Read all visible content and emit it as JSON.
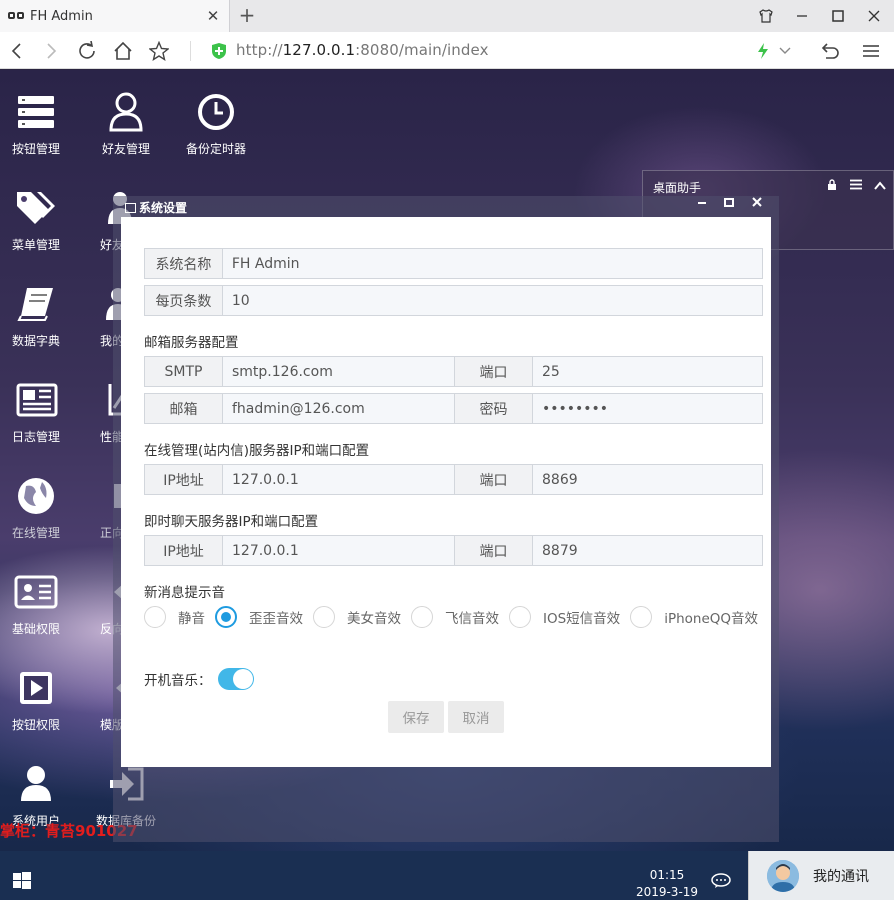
{
  "browser": {
    "tab_title": "FH Admin",
    "url_prefix": "http://",
    "url_host": "127.0.0.1",
    "url_rest": ":8080/main/index"
  },
  "desktop_icons": [
    {
      "label": "按钮管理",
      "icon": "server-list-icon"
    },
    {
      "label": "好友管理",
      "icon": "user-icon"
    },
    {
      "label": "备份定时器",
      "icon": "clock-icon"
    },
    {
      "label": "菜单管理",
      "icon": "tags-icon"
    },
    {
      "label": "好友",
      "icon": "users-icon"
    },
    {
      "label": "数据字典",
      "icon": "book-icon"
    },
    {
      "label": "我的",
      "icon": "users-icon"
    },
    {
      "label": "日志管理",
      "icon": "newspaper-icon"
    },
    {
      "label": "性能",
      "icon": "chart-icon"
    },
    {
      "label": "在线管理",
      "icon": "globe-icon"
    },
    {
      "label": "正向",
      "icon": "puzzle-icon"
    },
    {
      "label": "基础权限",
      "icon": "id-card-icon"
    },
    {
      "label": "反向",
      "icon": "arrow-icon"
    },
    {
      "label": "按钮权限",
      "icon": "play-icon"
    },
    {
      "label": "模版",
      "icon": "template-icon"
    },
    {
      "label": "系统用户",
      "icon": "user-icon"
    },
    {
      "label": "数据库备份",
      "icon": "sign-in-icon"
    }
  ],
  "watermark": "掌柜：青苔901027",
  "helper": {
    "title": "桌面助手"
  },
  "dialog": {
    "title": "系统设置",
    "system_name_label": "系统名称",
    "system_name_value": "FH Admin",
    "page_size_label": "每页条数",
    "page_size_value": "10",
    "mail_section": "邮箱服务器配置",
    "smtp_label": "SMTP",
    "smtp_value": "smtp.126.com",
    "smtp_port_label": "端口",
    "smtp_port_value": "25",
    "mail_label": "邮箱",
    "mail_value": "fhadmin@126.com",
    "password_label": "密码",
    "password_value": "••••••••",
    "online_section": "在线管理(站内信)服务器IP和端口配置",
    "online_ip_label": "IP地址",
    "online_ip_value": "127.0.0.1",
    "online_port_label": "端口",
    "online_port_value": "8869",
    "chat_section": "即时聊天服务器IP和端口配置",
    "chat_ip_label": "IP地址",
    "chat_ip_value": "127.0.0.1",
    "chat_port_label": "端口",
    "chat_port_value": "8879",
    "sound_section": "新消息提示音",
    "sounds": [
      "静音",
      "歪歪音效",
      "美女音效",
      "飞信音效",
      "IOS短信音效",
      "iPhoneQQ音效"
    ],
    "selected_sound": "歪歪音效",
    "boot_music_label": "开机音乐：",
    "boot_music_on": true,
    "save_label": "保存",
    "cancel_label": "取消"
  },
  "taskbar": {
    "time": "01:15",
    "date": "2019-3-19",
    "im_label": "我的通讯"
  }
}
